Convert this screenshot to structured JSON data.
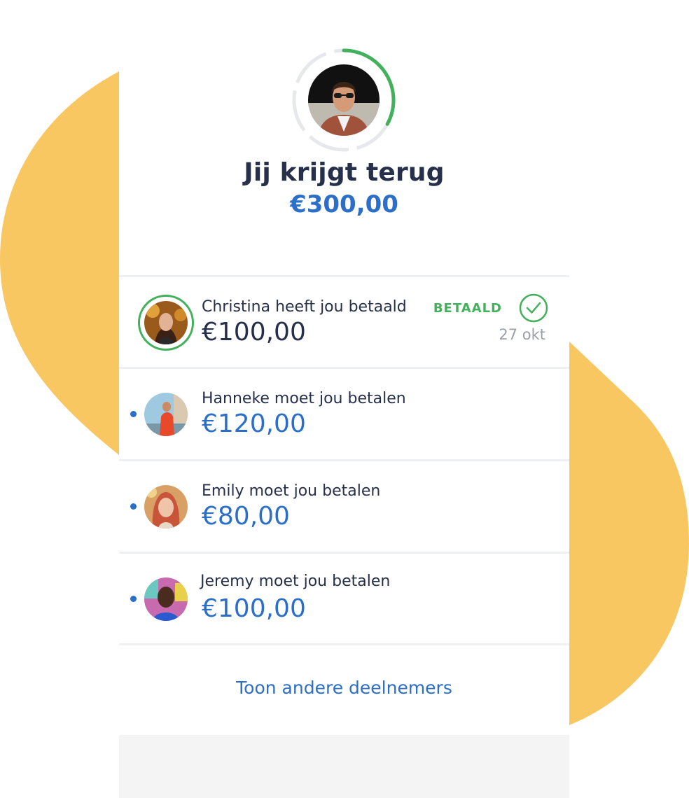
{
  "colors": {
    "accent_blue": "#2c6fc9",
    "paid_green": "#43b05c",
    "blob_yellow": "#f9c762",
    "text_dark": "#26304a",
    "text_muted": "#9aa0a8"
  },
  "summary": {
    "title": "Jij krijgt terug",
    "amount": "€300,00",
    "progress_fraction": 0.33,
    "avatar_icon": "person-avatar-sunglasses"
  },
  "participants": [
    {
      "label": "Christina heeft jou betaald",
      "amount": "€100,00",
      "status": "BETAALD",
      "date": "27 okt",
      "paid": true
    },
    {
      "label": "Hanneke moet jou betalen",
      "amount": "€120,00",
      "paid": false
    },
    {
      "label": "Emily moet jou betalen",
      "amount": "€80,00",
      "paid": false
    },
    {
      "label": "Jeremy moet jou betalen",
      "amount": "€100,00",
      "paid": false
    }
  ],
  "more_link": "Toon andere deelnemers"
}
